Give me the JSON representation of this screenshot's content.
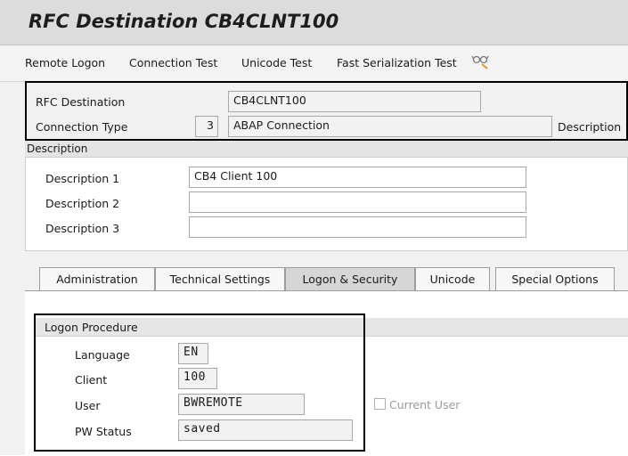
{
  "header": {
    "title": "RFC Destination CB4CLNT100"
  },
  "toolbar": {
    "remote_logon": "Remote Logon",
    "connection_test": "Connection Test",
    "unicode_test": "Unicode Test",
    "fast_serialization_test": "Fast Serialization Test",
    "extra_icon": "glasses-icon"
  },
  "destination": {
    "rfc_destination_label": "RFC Destination",
    "rfc_destination_value": "CB4CLNT100",
    "connection_type_label": "Connection Type",
    "connection_type_code": "3",
    "connection_type_value": "ABAP Connection",
    "description_button": "Description"
  },
  "description_group": {
    "title": "Description",
    "rows": [
      {
        "label": "Description 1",
        "value": "CB4 Client 100"
      },
      {
        "label": "Description 2",
        "value": ""
      },
      {
        "label": "Description 3",
        "value": ""
      }
    ]
  },
  "tabs": [
    {
      "label": "Administration"
    },
    {
      "label": "Technical Settings"
    },
    {
      "label": "Logon & Security",
      "active": true
    },
    {
      "label": "Unicode"
    },
    {
      "label": "Special Options"
    }
  ],
  "logon_procedure": {
    "title": "Logon Procedure",
    "language_label": "Language",
    "language_value": "EN",
    "client_label": "Client",
    "client_value": "100",
    "user_label": "User",
    "user_value": "BWREMOTE",
    "pw_status_label": "PW Status",
    "pw_status_value": "saved",
    "current_user_label": "Current User",
    "current_user_checked": false
  }
}
